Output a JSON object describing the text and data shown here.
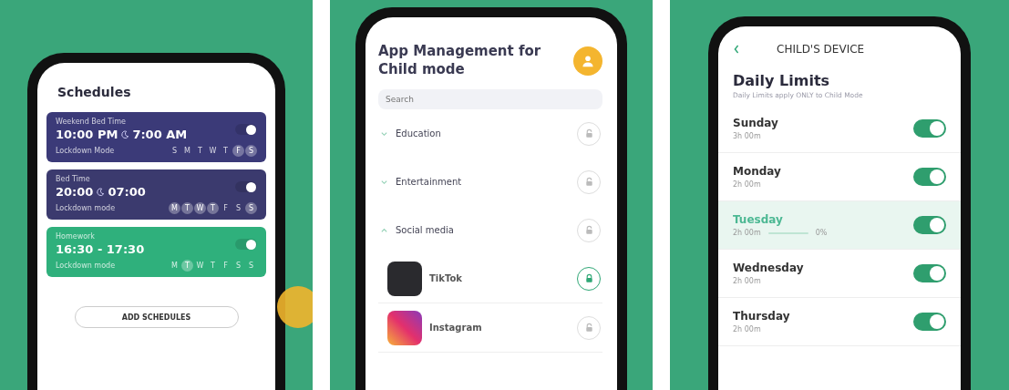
{
  "schedules_screen": {
    "title": "Schedules",
    "cards": [
      {
        "name": "Weekend Bed Time",
        "time_start": "10:00 PM",
        "time_end": "7:00 AM",
        "kind": "night",
        "color": "#3b3a78",
        "on": true,
        "mode": "Lockdown Mode",
        "days": [
          {
            "label": "S",
            "selected": false
          },
          {
            "label": "M",
            "selected": false
          },
          {
            "label": "T",
            "selected": false
          },
          {
            "label": "W",
            "selected": false
          },
          {
            "label": "T",
            "selected": false
          },
          {
            "label": "F",
            "selected": true
          },
          {
            "label": "S",
            "selected": true
          }
        ]
      },
      {
        "name": "Bed Time",
        "time_start": "20:00",
        "time_end": "07:00",
        "kind": "night",
        "color": "#3b3a6e",
        "on": true,
        "mode": "Lockdown mode",
        "days": [
          {
            "label": "M",
            "selected": true
          },
          {
            "label": "T",
            "selected": true
          },
          {
            "label": "W",
            "selected": true
          },
          {
            "label": "T",
            "selected": true
          },
          {
            "label": "F",
            "selected": false
          },
          {
            "label": "S",
            "selected": false
          },
          {
            "label": "S",
            "selected": true
          }
        ]
      },
      {
        "name": "Homework",
        "time_start": "16:30 - 17:30",
        "kind": "range",
        "color": "#2fb07c",
        "on": true,
        "mode": "Lockdown mode",
        "days": [
          {
            "label": "M",
            "selected": false
          },
          {
            "label": "T",
            "selected": true
          },
          {
            "label": "W",
            "selected": false
          },
          {
            "label": "T",
            "selected": false
          },
          {
            "label": "F",
            "selected": false
          },
          {
            "label": "S",
            "selected": false
          },
          {
            "label": "S",
            "selected": false
          }
        ]
      }
    ],
    "add_button": "ADD SCHEDULES"
  },
  "apps_screen": {
    "title": "App Management for Child mode",
    "search": {
      "placeholder": "Search"
    },
    "items": [
      {
        "kind": "category",
        "label": "Education",
        "expanded": false,
        "locked": false
      },
      {
        "kind": "category",
        "label": "Entertainment",
        "expanded": false,
        "locked": false
      },
      {
        "kind": "category",
        "label": "Social media",
        "expanded": true,
        "locked": false
      },
      {
        "kind": "app",
        "label": "TikTok",
        "locked": true
      },
      {
        "kind": "app",
        "label": "Instagram",
        "locked": false
      }
    ]
  },
  "limits_screen": {
    "header": "CHILD'S DEVICE",
    "title": "Daily Limits",
    "subtitle": "Daily Limits apply ONLY to Child Mode",
    "days": [
      {
        "name": "Sunday",
        "time": "3h 00m",
        "on": true,
        "selected": false
      },
      {
        "name": "Monday",
        "time": "2h 00m",
        "on": true,
        "selected": false
      },
      {
        "name": "Tuesday",
        "time": "2h 00m",
        "on": true,
        "selected": true,
        "level": 0,
        "percent": "0%"
      },
      {
        "name": "Wednesday",
        "time": "2h 00m",
        "on": true,
        "selected": false
      },
      {
        "name": "Thursday",
        "time": "2h 00m",
        "on": true,
        "selected": false
      }
    ]
  }
}
